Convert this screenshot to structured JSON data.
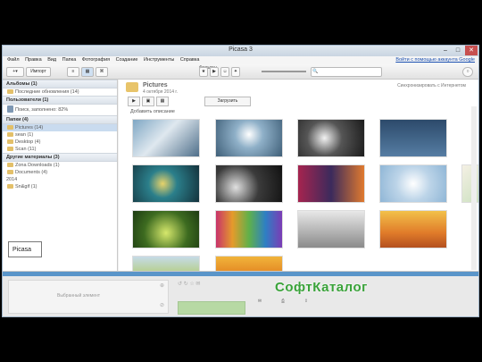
{
  "window": {
    "title": "Picasa 3",
    "controls": [
      "–",
      "□",
      "✕"
    ]
  },
  "menu": {
    "items": [
      "Файл",
      "Правка",
      "Вид",
      "Папка",
      "Фотография",
      "Создание",
      "Инструменты",
      "Справка"
    ],
    "signin": "Войти с помощью аккаунта Google"
  },
  "toolbar": {
    "import": "Импорт",
    "filters": "Фильтры"
  },
  "sidebar": {
    "sections": [
      {
        "title": "Альбомы (1)",
        "items": [
          {
            "label": "Последние обновления (14)"
          }
        ]
      },
      {
        "title": "Пользователи (1)",
        "items": [
          {
            "label": "Поиск, заполнено: 82%"
          }
        ]
      },
      {
        "title": "Папки (4)",
        "items": [
          {
            "label": "Pictures (14)"
          },
          {
            "label": "sean (1)"
          },
          {
            "label": "Desktop (4)"
          },
          {
            "label": "Scan (11)"
          }
        ]
      },
      {
        "title": "Другие материалы (3)",
        "items": [
          {
            "label": "Zona Downloads (1)"
          },
          {
            "label": "Documents (4)"
          }
        ]
      }
    ],
    "year": "2014",
    "year_items": [
      {
        "label": "Sn&gif (1)"
      }
    ]
  },
  "main": {
    "folder_title": "Pictures",
    "folder_date": "4 октября 2014 г.",
    "sync_label": "Синхронизировать с Интернетом",
    "play_icon": "play-icon",
    "share_label": "Загрузить",
    "add_description": "Добавить описание"
  },
  "bottom": {
    "selected_label": "Выбранный элемент",
    "watermark": "СофтКаталог"
  },
  "overlay": {
    "label": "Picasa"
  },
  "thumb_colors": [
    "#5b7f9a",
    "#7b8ea0",
    "#39425a",
    "#2e4b6f",
    "#1f3b4a",
    "#3f3f3f",
    "#6a4d8a",
    "#c9d9e6",
    "#5d7f2f",
    "#7a2c6e",
    "#8b8b8b",
    "#d9a24b",
    "#8fb25a",
    "#c8a265"
  ]
}
